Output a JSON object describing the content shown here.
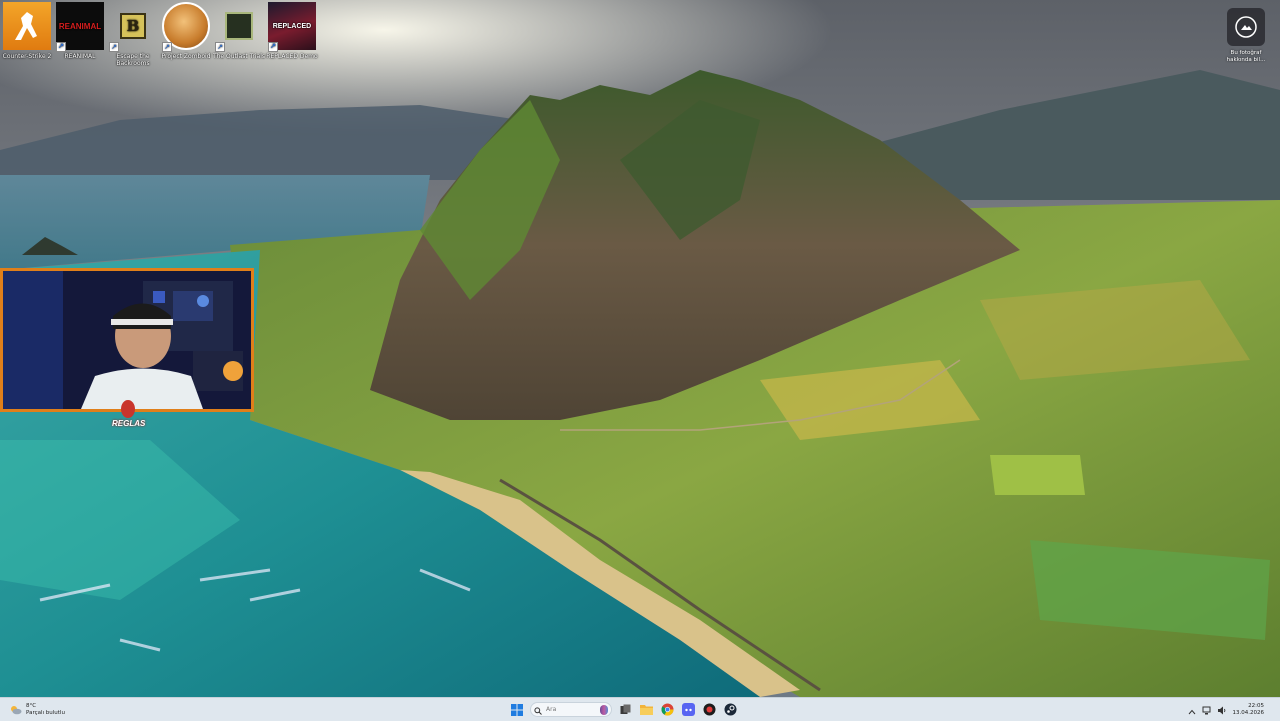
{
  "desktop": {
    "icons": [
      {
        "label": "Counter-Strike 2",
        "icon": "counter-strike-icon"
      },
      {
        "label": "REANIMAL",
        "icon": "reanimal-icon",
        "tile_text": "REANIMAL"
      },
      {
        "label": "Escape the Backrooms",
        "icon": "escape-backrooms-icon",
        "tile_text": "B"
      },
      {
        "label": "Project Zomboid",
        "icon": "project-zomboid-icon"
      },
      {
        "label": "The Outlast Trials",
        "icon": "outlast-trials-icon"
      },
      {
        "label": "REPLACED Demo",
        "icon": "replaced-icon",
        "tile_text": "REPLACED"
      }
    ],
    "bing_widget": {
      "label": "Bu fotoğraf hakkında bil...",
      "icon": "bing-camera-icon"
    }
  },
  "webcam": {
    "name": "REGLAS"
  },
  "taskbar": {
    "weather": {
      "temp": "8°C",
      "condition": "Parçalı bulutlu",
      "icon": "cloud-sun-icon"
    },
    "start_icon": "windows-start-icon",
    "search": {
      "placeholder": "Ara",
      "icon": "search-icon"
    },
    "pinned": [
      {
        "name": "task-view",
        "icon": "task-view-icon"
      },
      {
        "name": "file-explorer",
        "icon": "folder-icon"
      },
      {
        "name": "chrome",
        "icon": "chrome-icon"
      },
      {
        "name": "discord",
        "icon": "discord-icon"
      },
      {
        "name": "app-red",
        "icon": "app-red-icon"
      },
      {
        "name": "steam",
        "icon": "steam-icon"
      }
    ],
    "tray": {
      "icons": [
        "chevron-up-icon",
        "network-icon",
        "volume-icon"
      ]
    },
    "clock": {
      "time": "22:05",
      "date": "13.04.2026"
    }
  },
  "colors": {
    "webcam_border": "#e07f1a",
    "taskbar_bg": "#dfe7ee"
  }
}
